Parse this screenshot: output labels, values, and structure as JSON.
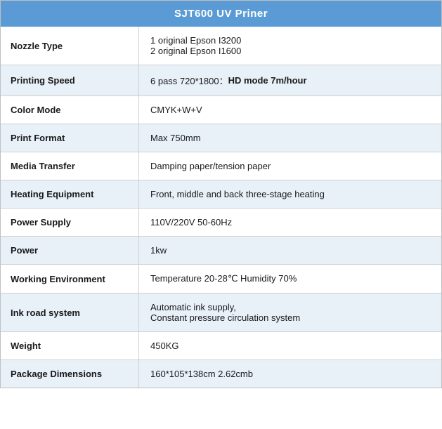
{
  "table": {
    "title": "SJT600 UV Priner",
    "rows": [
      {
        "id": "nozzle-type",
        "label": "Nozzle Type",
        "value": "1 original Epson I3200\n2 original Epson I1600",
        "multiline": true,
        "alt": false
      },
      {
        "id": "printing-speed",
        "label": "Printing Speed",
        "value_prefix": "6 pass 720*1800：",
        "value_bold": "HD mode 7m/hour",
        "has_bold": true,
        "alt": true
      },
      {
        "id": "color-mode",
        "label": "Color Mode",
        "value": "CMYK+W+V",
        "alt": false
      },
      {
        "id": "print-format",
        "label": "Print Format",
        "value": "Max 750mm",
        "alt": true
      },
      {
        "id": "media-transfer",
        "label": "Media Transfer",
        "value": "Damping paper/tension paper",
        "alt": false
      },
      {
        "id": "heating-equipment",
        "label": "Heating Equipment",
        "value": "Front, middle and back three-stage heating",
        "alt": true
      },
      {
        "id": "power-supply",
        "label": "Power Supply",
        "value": "110V/220V 50-60Hz",
        "alt": false
      },
      {
        "id": "power",
        "label": "Power",
        "value": "1kw",
        "alt": true
      },
      {
        "id": "working-environment",
        "label": "Working Environment",
        "value": "Temperature 20-28℃ Humidity 70%",
        "alt": false
      },
      {
        "id": "ink-road-system",
        "label": "Ink road system",
        "value": "Automatic ink supply,\nConstant pressure circulation system",
        "multiline": true,
        "alt": true
      },
      {
        "id": "weight",
        "label": "Weight",
        "value": "450KG",
        "alt": false
      },
      {
        "id": "package-dimensions",
        "label": "Package Dimensions",
        "value": "160*105*138cm 2.62cmb",
        "alt": true
      }
    ]
  }
}
